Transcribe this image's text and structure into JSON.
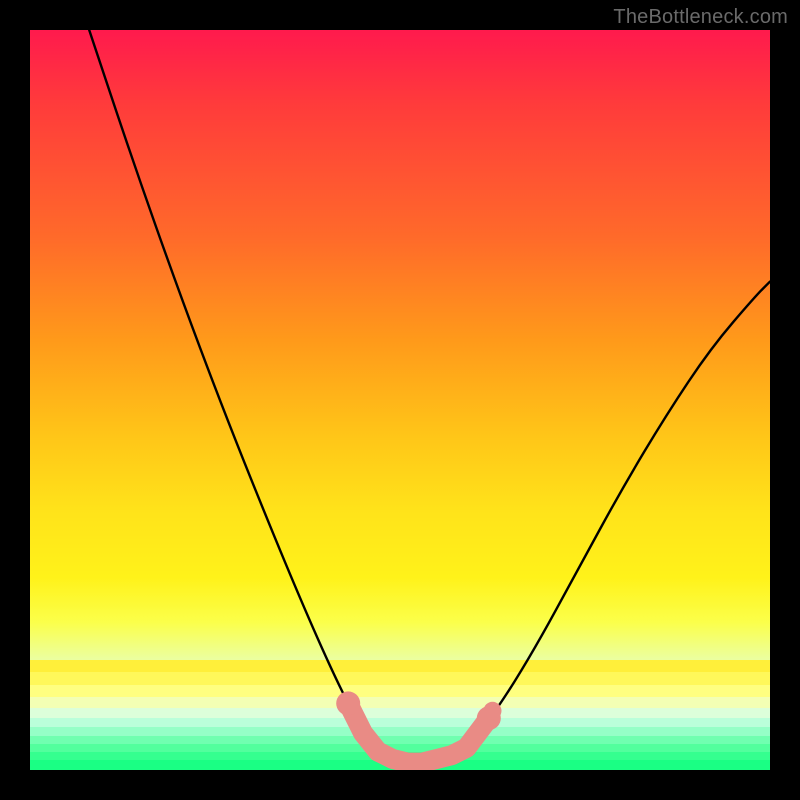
{
  "watermark": "TheBottleneck.com",
  "chart_data": {
    "type": "line",
    "title": "",
    "xlabel": "",
    "ylabel": "",
    "xlim": [
      0,
      100
    ],
    "ylim": [
      0,
      100
    ],
    "grid": false,
    "legend": false,
    "annotations": [],
    "background": {
      "gradient": [
        {
          "pos": 0,
          "color": "#ff1a4d"
        },
        {
          "pos": 10,
          "color": "#ff3b3b"
        },
        {
          "pos": 28,
          "color": "#ff6a2a"
        },
        {
          "pos": 42,
          "color": "#ff9a1a"
        },
        {
          "pos": 55,
          "color": "#ffc618"
        },
        {
          "pos": 65,
          "color": "#ffe31a"
        },
        {
          "pos": 74,
          "color": "#fff21a"
        },
        {
          "pos": 80,
          "color": "#fbff4a"
        },
        {
          "pos": 86,
          "color": "#e8ffb0"
        },
        {
          "pos": 90,
          "color": "#9fffd8"
        },
        {
          "pos": 94,
          "color": "#4dffa8"
        },
        {
          "pos": 100,
          "color": "#1aff84"
        }
      ]
    },
    "series": [
      {
        "name": "bottleneck-curve",
        "color": "#000000",
        "x": [
          8,
          14,
          20,
          26,
          32,
          37,
          41,
          44,
          47,
          50,
          53,
          56,
          59,
          63,
          68,
          74,
          80,
          86,
          92,
          98,
          100
        ],
        "y": [
          100,
          82,
          65,
          49,
          34,
          22,
          13,
          7,
          3,
          1,
          1,
          1,
          3,
          8,
          16,
          27,
          38,
          48,
          57,
          64,
          66
        ]
      }
    ],
    "markers": {
      "name": "highlight-range",
      "color": "#e98b85",
      "points": [
        {
          "x": 43,
          "y": 9
        },
        {
          "x": 45,
          "y": 5
        },
        {
          "x": 47,
          "y": 2.5
        },
        {
          "x": 49,
          "y": 1.5
        },
        {
          "x": 51,
          "y": 1
        },
        {
          "x": 53,
          "y": 1
        },
        {
          "x": 55,
          "y": 1.5
        },
        {
          "x": 57,
          "y": 2
        },
        {
          "x": 59,
          "y": 3
        },
        {
          "x": 62,
          "y": 7
        }
      ]
    }
  }
}
